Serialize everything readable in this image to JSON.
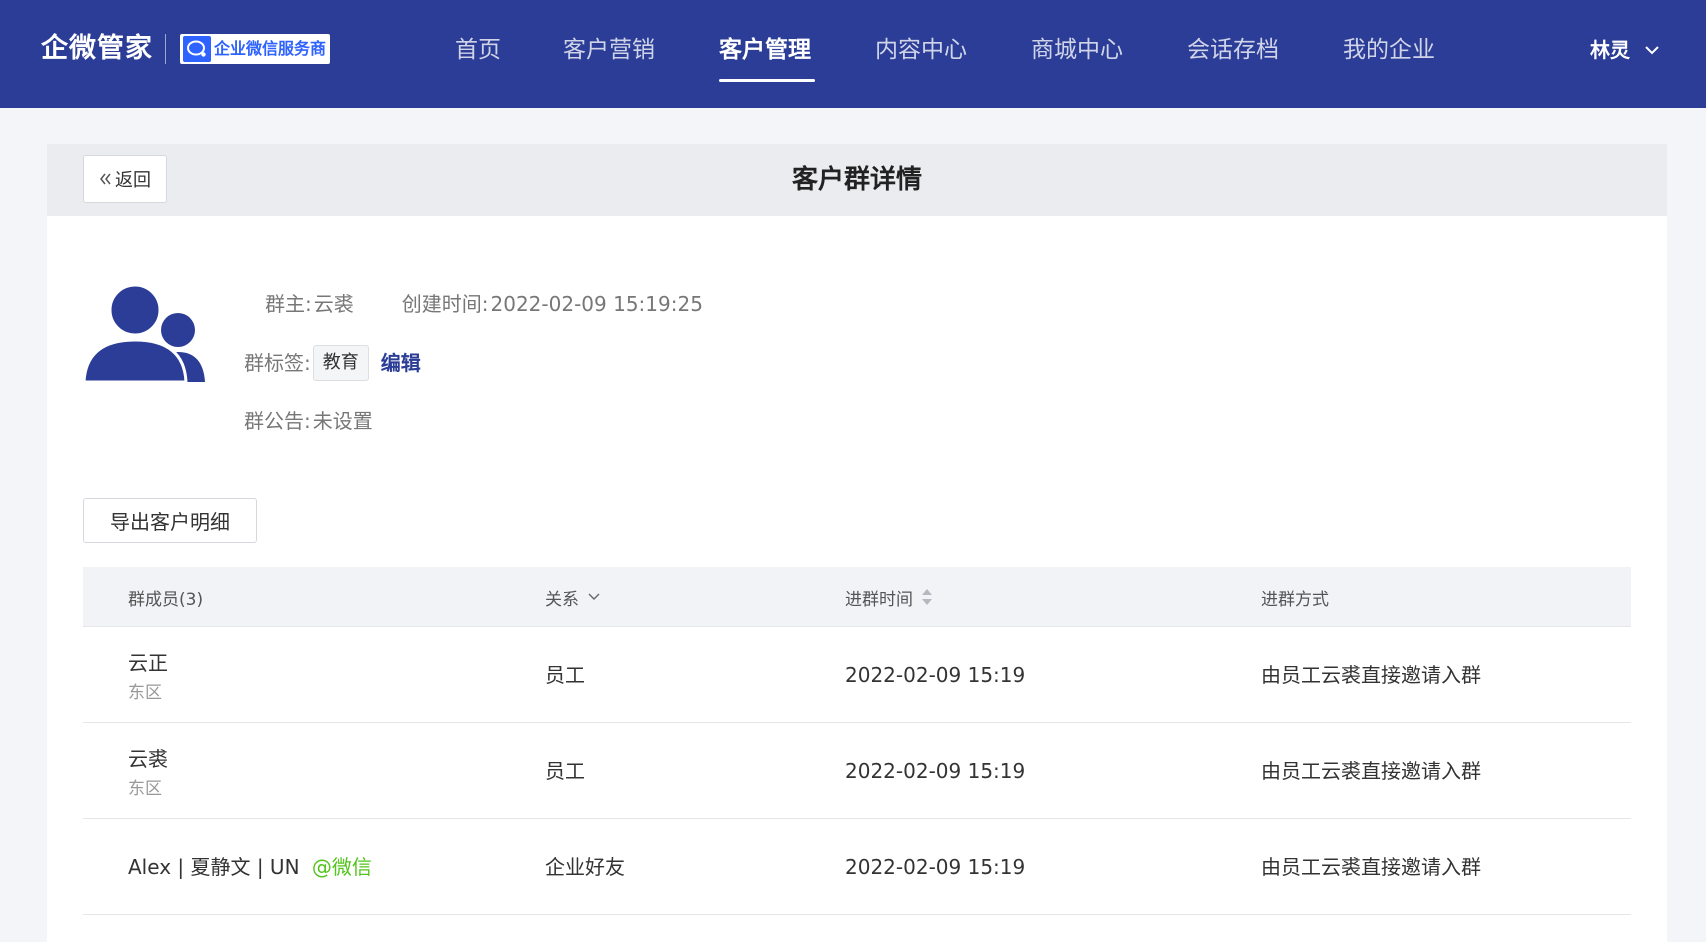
{
  "app": {
    "brand_name": "企微管家",
    "badge_text": "企业微信服务商"
  },
  "nav": {
    "items": [
      {
        "label": "首页"
      },
      {
        "label": "客户营销"
      },
      {
        "label": "客户管理"
      },
      {
        "label": "内容中心"
      },
      {
        "label": "商城中心"
      },
      {
        "label": "会话存档"
      },
      {
        "label": "我的企业"
      }
    ],
    "active": "客户管理"
  },
  "user": {
    "name": "林灵"
  },
  "header": {
    "back_label": "返回",
    "title": "客户群详情"
  },
  "group": {
    "owner_label": "群主:",
    "owner": "云裘",
    "created_label": "创建时间:",
    "created": "2022-02-09 15:19:25",
    "tags_label": "群标签:",
    "tag": "教育",
    "edit_label": "编辑",
    "notice_label": "群公告:",
    "notice": "未设置"
  },
  "actions": {
    "export_label": "导出客户明细"
  },
  "table": {
    "columns": {
      "member": "群成员(3)",
      "relation": "关系",
      "join_time": "进群时间",
      "join_method": "进群方式"
    },
    "rows": [
      {
        "name": "云正",
        "dept": "东区",
        "relation": "员工",
        "join_time": "2022-02-09 15:19",
        "join_method": "由员工云裘直接邀请入群"
      },
      {
        "name": "云裘",
        "dept": "东区",
        "relation": "员工",
        "join_time": "2022-02-09 15:19",
        "join_method": "由员工云裘直接邀请入群"
      },
      {
        "name": "Alex | 夏静文 | UN",
        "wechat_tag": "@微信",
        "relation": "企业好友",
        "join_time": "2022-02-09 15:19",
        "join_method": "由员工云裘直接邀请入群"
      }
    ]
  },
  "colors": {
    "nav_bg": "#2b3d96",
    "accent": "#2b3d96",
    "wechat_green": "#52c41a",
    "badge_blue": "#2f63ff"
  },
  "icons": [
    "users-avatar-icon",
    "chat-bubble-icon",
    "chevron-down-icon",
    "double-chevron-left-icon",
    "sort-icon"
  ]
}
